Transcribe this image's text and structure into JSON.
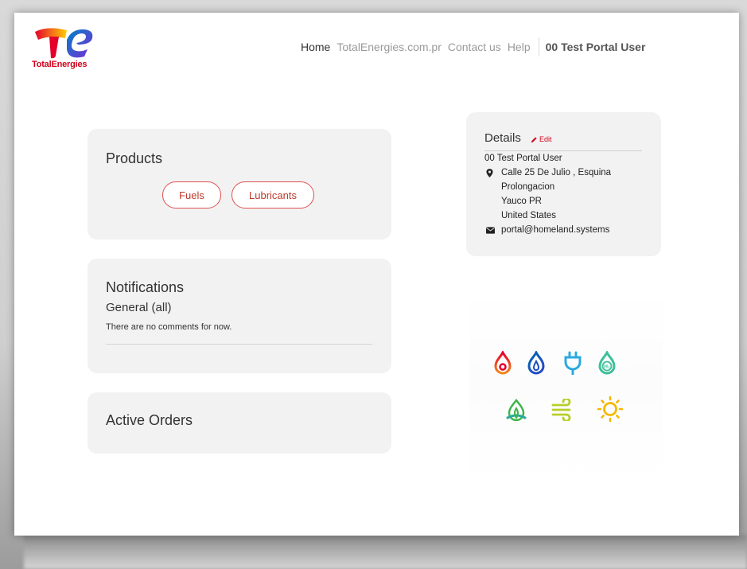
{
  "brand": {
    "name": "TotalEnergies",
    "accent": "#d0021b"
  },
  "nav": {
    "items": [
      "Home",
      "TotalEnergies.com.pr",
      "Contact us",
      "Help"
    ],
    "user": "00 Test Portal User"
  },
  "products": {
    "title": "Products",
    "buttons": [
      "Fuels",
      "Lubricants"
    ]
  },
  "notifications": {
    "title": "Notifications",
    "subtitle": "General (all)",
    "empty_text": "There are no comments for now."
  },
  "orders": {
    "title": "Active Orders"
  },
  "details": {
    "title": "Details",
    "edit_label": "Edit",
    "name": "00 Test Portal User",
    "address": [
      "Calle 25 De Julio , Esquina",
      "Prolongacion",
      "Yauco PR",
      "United States"
    ],
    "email": "portal@homeland.systems"
  },
  "energy_icons": [
    "flame-icon",
    "gas-drop-icon",
    "electric-plug-icon",
    "hydrogen-icon",
    "biomass-icon",
    "wind-icon",
    "sun-icon"
  ]
}
